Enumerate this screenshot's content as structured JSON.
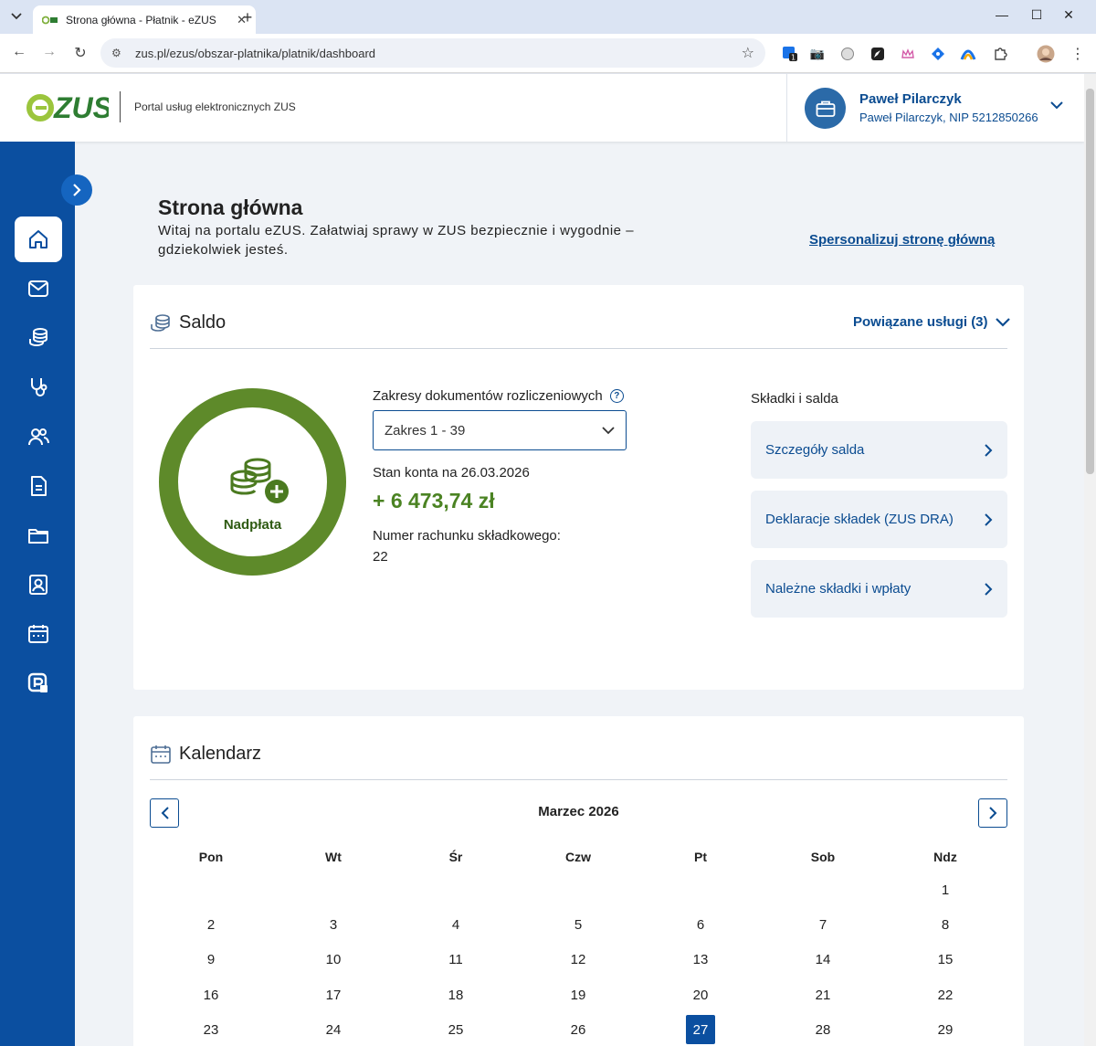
{
  "browser": {
    "tab_title": "Strona główna - Płatnik - eZUS",
    "url": "zus.pl/ezus/obszar-platnika/platnik/dashboard"
  },
  "header": {
    "portal_name": "Portal usług elektronicznych ZUS",
    "user_name": "Paweł Pilarczyk",
    "user_detail": "Paweł Pilarczyk, NIP 5212850266"
  },
  "sidebar": {
    "items": [
      {
        "icon": "home-icon",
        "active": true
      },
      {
        "icon": "mail-icon",
        "active": false
      },
      {
        "icon": "coins-icon",
        "active": false
      },
      {
        "icon": "stethoscope-icon",
        "active": false
      },
      {
        "icon": "people-icon",
        "active": false
      },
      {
        "icon": "document-icon",
        "active": false
      },
      {
        "icon": "folder-icon",
        "active": false
      },
      {
        "icon": "id-card-icon",
        "active": false
      },
      {
        "icon": "calendar-icon",
        "active": false
      },
      {
        "icon": "payment-icon",
        "active": false
      }
    ]
  },
  "main": {
    "title": "Strona główna",
    "description": "Witaj na portalu eZUS. Załatwiaj sprawy w ZUS bezpiecznie i wygodnie – gdziekolwiek jesteś.",
    "personalize_link": "Spersonalizuj stronę główną"
  },
  "saldo": {
    "title": "Saldo",
    "related_services": "Powiązane usługi (3)",
    "status_label": "Nadpłata",
    "range_label": "Zakresy dokumentów rozliczeniowych",
    "range_value": "Zakres 1 - 39",
    "balance_date_label": "Stan konta na 26.03.2026",
    "balance_amount": "+ 6 473,74 zł",
    "account_number_label": "Numer rachunku składkowego:",
    "account_number": "22",
    "links_title": "Składki i salda",
    "links": [
      {
        "label": "Szczegóły salda"
      },
      {
        "label": "Deklaracje składek (ZUS DRA)"
      },
      {
        "label": "Należne składki i wpłaty"
      }
    ]
  },
  "calendar": {
    "title": "Kalendarz",
    "month": "Marzec 2026",
    "weekdays": [
      "Pon",
      "Wt",
      "Śr",
      "Czw",
      "Pt",
      "Sob",
      "Ndz"
    ],
    "weeks": [
      [
        "",
        "",
        "",
        "",
        "",
        "",
        "1"
      ],
      [
        "2",
        "3",
        "4",
        "5",
        "6",
        "7",
        "8"
      ],
      [
        "9",
        "10",
        "11",
        "12",
        "13",
        "14",
        "15"
      ],
      [
        "16",
        "17",
        "18",
        "19",
        "20",
        "21",
        "22"
      ],
      [
        "23",
        "24",
        "25",
        "26",
        "27",
        "28",
        "29"
      ]
    ],
    "today": "27"
  },
  "colors": {
    "brand_blue": "#0b4fa0",
    "link_blue": "#0b4c91",
    "overpayment_green": "#4b8323"
  }
}
